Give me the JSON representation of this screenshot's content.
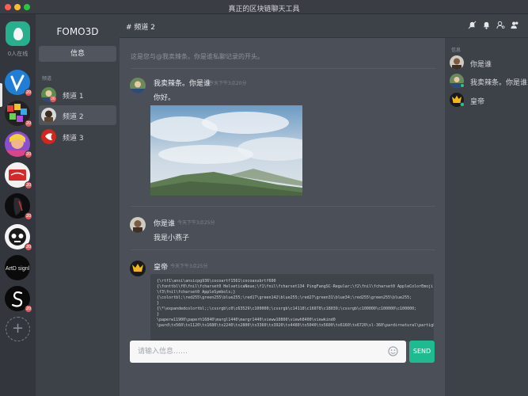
{
  "window": {
    "title": "真正的区块链聊天工具"
  },
  "rail": {
    "online_count": "0人在线",
    "servers": [
      {
        "name": "server-v",
        "badge": "20"
      },
      {
        "name": "server-colorful",
        "badge": "20"
      },
      {
        "name": "server-portrait",
        "badge": "20"
      },
      {
        "name": "server-cola",
        "badge": "20"
      },
      {
        "name": "server-dark-portrait",
        "badge": "20"
      },
      {
        "name": "server-robot",
        "badge": "20"
      },
      {
        "name": "server-arc-signl",
        "badge": ""
      },
      {
        "name": "server-s",
        "badge": "20"
      }
    ],
    "add_label": "+"
  },
  "channels": {
    "server_name": "FOMO3D",
    "info_label": "信息",
    "section_label": "频道",
    "items": [
      {
        "label": "频道 1",
        "badge": "20"
      },
      {
        "label": "频道 2",
        "badge": ""
      },
      {
        "label": "频道 3",
        "badge": ""
      }
    ]
  },
  "header": {
    "channel_title": "# 频道 2"
  },
  "chat": {
    "welcome": "这是您与@我卖辣条。你是谁私聊记录的开头。",
    "messages": [
      {
        "author": "我卖辣条。你是谁",
        "time": "今天下午3点20分",
        "text": "你好。",
        "has_image": true
      },
      {
        "author": "你是谁",
        "time": "今天下午3点25分",
        "text": "我是小燕子"
      },
      {
        "author": "皇帝",
        "time": "今天下午3点25分",
        "code": "{\\rtf1\\ansi\\ansicpg936\\cocoartf1561\\cocoasubrtf600\n{\\fonttbl\\f0\\fnil\\fcharset0 HelveticaNeue;\\f1\\fnil\\fcharset134 PingFangSC-Regular;\\f2\\fnil\\fcharset0 AppleColorEmoji;\n\\f3\\fnil\\fcharset0 AppleSymbols;}\n{\\colortbl;\\red255\\green255\\blue255;\\red17\\green142\\blue255;\\red27\\green31\\blue34;\\red255\\green255\\blue255;\n}\n{\\*\\expandedcolortbl;;\\cssrgb\\c0\\c63529\\c100000;\\cssrgb\\c14118\\c16078\\c18039;\\cssrgb\\c100000\\c100000\\c100000;\n}\n\\paperw11900\\paperh16840\\margl1440\\margr1440\\vieww10800\\viewh8400\\viewkind0\n\\pard\\tx560\\tx1120\\tx1680\\tx2240\\tx2800\\tx3360\\tx3920\\tx4480\\tx5040\\tx5600\\tx6160\\tx6720\\sl-360\\pardirnatural\\partightenfactor0"
      }
    ]
  },
  "composer": {
    "placeholder": "请输入信息……",
    "send_label": "SEND"
  },
  "members": {
    "section_label": "信息",
    "items": [
      {
        "name": "你是谁"
      },
      {
        "name": "我卖辣条。你是谁"
      },
      {
        "name": "皇帝"
      }
    ]
  },
  "colors": {
    "accent": "#1dbb8f",
    "badge": "#e35c5c",
    "sidebar": "#33363c",
    "panel": "#3d4148",
    "chat_bg": "#4a4f58"
  }
}
